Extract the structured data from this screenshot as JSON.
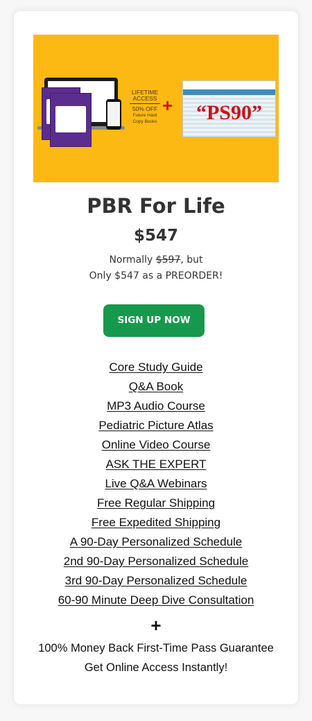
{
  "product": {
    "title": "PBR For Life",
    "price": "$547",
    "normally_prefix": "Normally ",
    "normally_old_price": "$597",
    "normally_suffix": ", but",
    "preorder_text": "Only $547 as a PREORDER!",
    "cta_label": "SIGN UP NOW"
  },
  "hero": {
    "promo_line1": "LIFETIME",
    "promo_line2": "ACCESS",
    "promo_line3": "50% OFF",
    "promo_line4": "Future Hard",
    "promo_line5": "Copy Books",
    "plus_symbol": "+",
    "sheet_label": "“PS90”",
    "background_color": "#fdb913",
    "accent_red": "#d2141a"
  },
  "features": [
    {
      "label": "Core Study Guide"
    },
    {
      "label": "Q&A Book"
    },
    {
      "label": "MP3 Audio Course "
    },
    {
      "label": "Pediatric Picture Atlas"
    },
    {
      "label": "Online Video Course"
    },
    {
      "label": "ASK THE EXPERT"
    },
    {
      "label": "Live Q&A Webinars"
    },
    {
      "label": "Free Regular Shipping"
    },
    {
      "label": "Free Expedited Shipping"
    },
    {
      "label": "A 90-Day Personalized Schedule"
    },
    {
      "label": "2nd 90-Day Personalized Schedule"
    },
    {
      "label": "3rd 90-Day Personalized Schedule"
    },
    {
      "label": "60-90 Minute Deep Dive Consultation"
    }
  ],
  "footer": {
    "plus_symbol": "+",
    "guarantee": "100% Money Back First-Time Pass Guarantee",
    "instant_access": "Get Online Access Instantly!"
  },
  "colors": {
    "cta_green": "#17994d",
    "text_dark": "#333333"
  }
}
